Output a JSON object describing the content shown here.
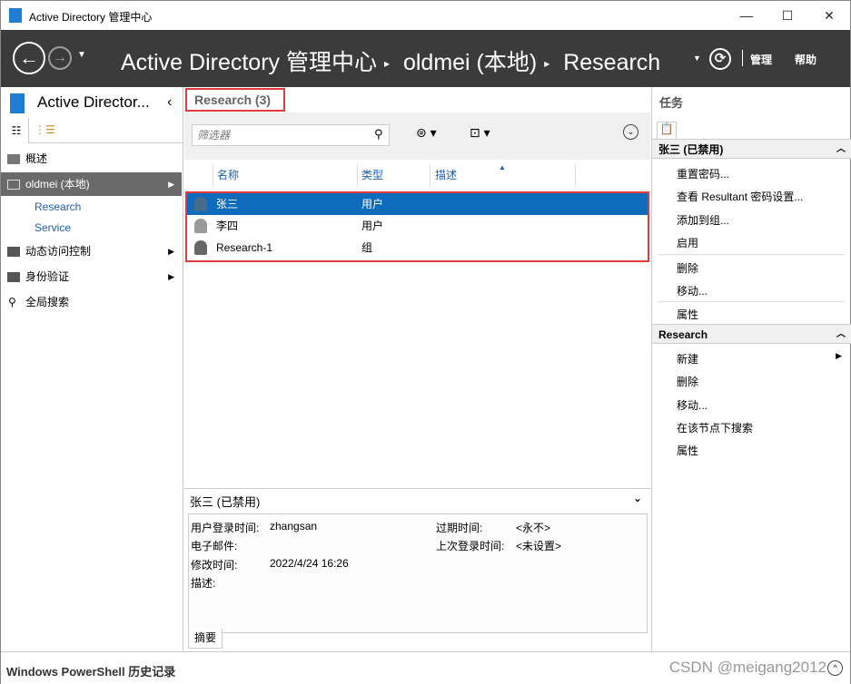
{
  "window": {
    "title": "Active Directory 管理中心",
    "minimize": "—",
    "maximize": "☐",
    "close": "✕"
  },
  "nav": {
    "back": "←",
    "forward": "→",
    "breadcrumb": [
      "Active Directory 管理中心",
      "oldmei (本地)",
      "Research"
    ],
    "manage": "管理",
    "help": "帮助",
    "refresh": "⟳"
  },
  "left": {
    "title": "Active Director...",
    "items": [
      {
        "label": "概述"
      },
      {
        "label": "oldmei (本地)"
      },
      {
        "label": "Research"
      },
      {
        "label": "Service"
      },
      {
        "label": "动态访问控制"
      },
      {
        "label": "身份验证"
      },
      {
        "label": "全局搜索"
      }
    ]
  },
  "center": {
    "header": "Research  (3)",
    "filter_placeholder": "筛选器",
    "columns": [
      "名称",
      "类型",
      "描述"
    ],
    "rows": [
      {
        "name": "张三",
        "type": "用户"
      },
      {
        "name": "李四",
        "type": "用户"
      },
      {
        "name": "Research-1",
        "type": "组"
      }
    ],
    "detail": {
      "title": "张三 (已禁用)",
      "fields": {
        "logon_label": "用户登录时间:",
        "logon": "zhangsan",
        "email_label": "电子邮件:",
        "modified_label": "修改时间:",
        "modified": "2022/4/24 16:26",
        "desc_label": "描述:",
        "expire_label": "过期时间:",
        "expire": "<永不>",
        "last_label": "上次登录时间:",
        "last": "<未设置>"
      },
      "tab": "摘要"
    }
  },
  "tasks": {
    "title": "任务",
    "section1": {
      "title": "张三 (已禁用)",
      "items": [
        "重置密码...",
        "查看 Resultant 密码设置...",
        "添加到组...",
        "启用",
        "删除",
        "移动...",
        "属性"
      ]
    },
    "section2": {
      "title": "Research",
      "items": [
        "新建",
        "删除",
        "移动...",
        "在该节点下搜索",
        "属性"
      ]
    }
  },
  "footer": {
    "title": "Windows PowerShell 历史记录",
    "watermark": "CSDN @meigang2012"
  }
}
